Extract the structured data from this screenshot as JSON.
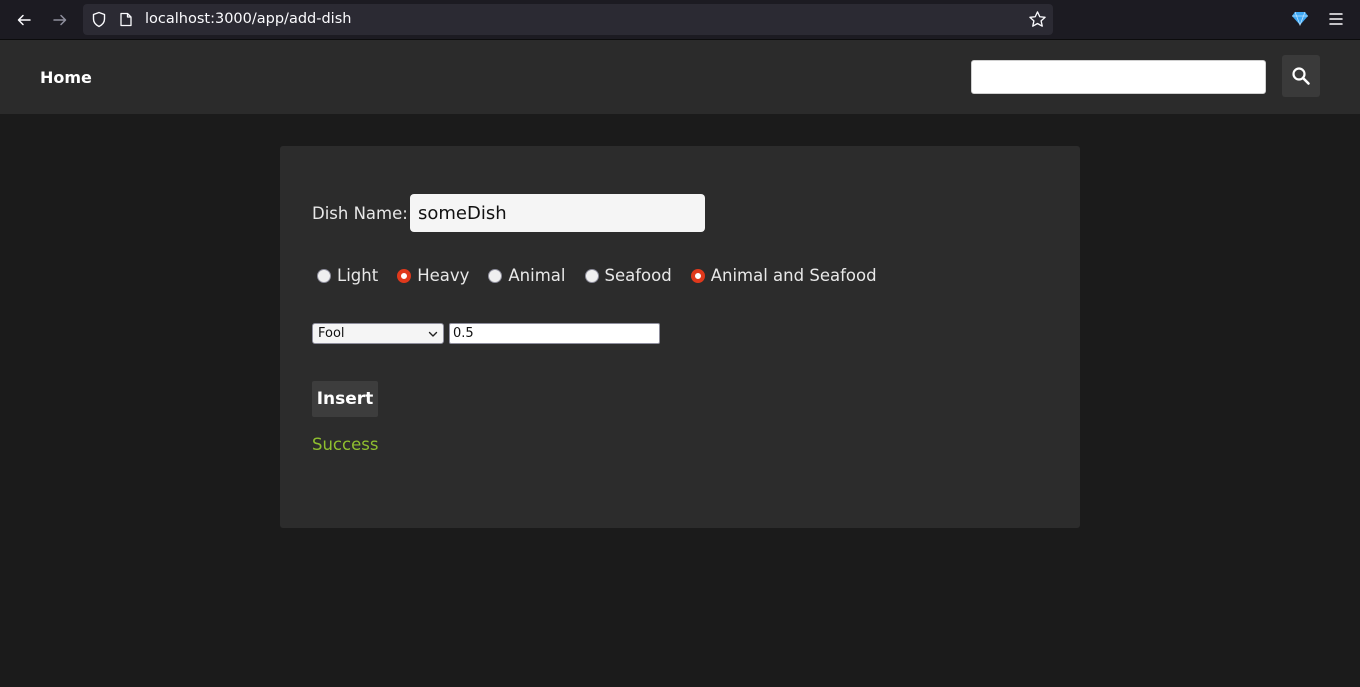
{
  "browser": {
    "url": "localhost:3000/app/add-dish",
    "icons": [
      "back-arrow-icon",
      "forward-arrow-icon",
      "shield-icon",
      "page-icon",
      "bookmark-star-icon",
      "extension-gem-icon",
      "hamburger-menu-icon"
    ]
  },
  "header": {
    "home_label": "Home",
    "search_value": "",
    "search_icon": "magnifier-icon"
  },
  "form": {
    "dish_label": "Dish Name:",
    "dish_value": "someDish",
    "radios": [
      {
        "label": "Light",
        "checked": false
      },
      {
        "label": "Heavy",
        "checked": true
      },
      {
        "label": "Animal",
        "checked": false
      },
      {
        "label": "Seafood",
        "checked": false
      },
      {
        "label": "Animal and Seafood",
        "checked": true
      }
    ],
    "ingredient_selected": "Fool",
    "quantity_value": "0.5",
    "insert_label": "Insert",
    "status_text": "Success"
  },
  "colors": {
    "page_bg": "#1b1b1b",
    "header_bg": "#2b2b2b",
    "card_bg": "#2c2c2c",
    "radio_checked": "#e0391c",
    "success": "#8fbf2f"
  }
}
